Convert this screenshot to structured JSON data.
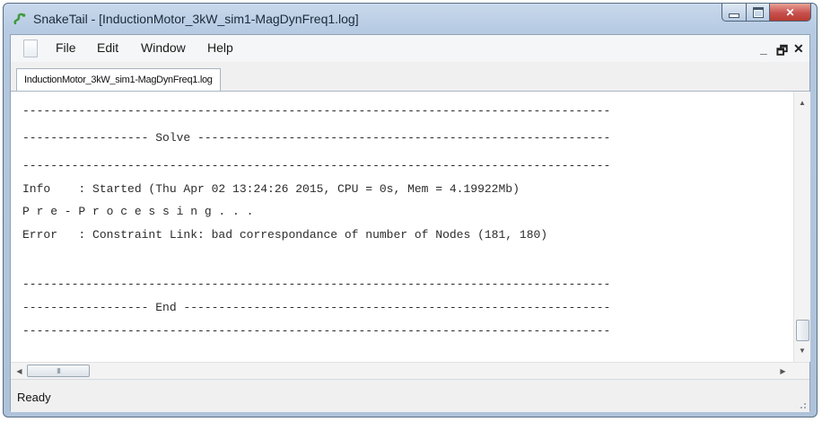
{
  "window": {
    "title": "SnakeTail - [InductionMotor_3kW_sim1-MagDynFreq1.log]"
  },
  "menu": {
    "items": [
      "File",
      "Edit",
      "Window",
      "Help"
    ],
    "mdi_controls": [
      "_",
      "🗗",
      "✕"
    ]
  },
  "tabs": [
    {
      "label": "InductionMotor_3kW_sim1-MagDynFreq1.log",
      "active": true
    }
  ],
  "log_lines": [
    "------------------------------------------------------------------------------------",
    "------------------ Solve -----------------------------------------------------------",
    "------------------------------------------------------------------------------------",
    "Info    : Started (Thu Apr 02 13:24:26 2015, CPU = 0s, Mem = 4.19922Mb)",
    "P r e - P r o c e s s i n g . . .",
    "Error   : Constraint Link: bad correspondance of number of Nodes (181, 180)",
    "",
    "------------------------------------------------------------------------------------",
    "------------------ End -------------------------------------------------------------",
    "------------------------------------------------------------------------------------"
  ],
  "scrollbars": {
    "h_thumb_grip": "III",
    "up": "▲",
    "down": "▼",
    "left": "◀",
    "right": "▶"
  },
  "status": {
    "text": "Ready"
  },
  "colors": {
    "frame": "#b7cbe3",
    "close_button": "#c75050",
    "log_text": "#2b2b2b"
  }
}
